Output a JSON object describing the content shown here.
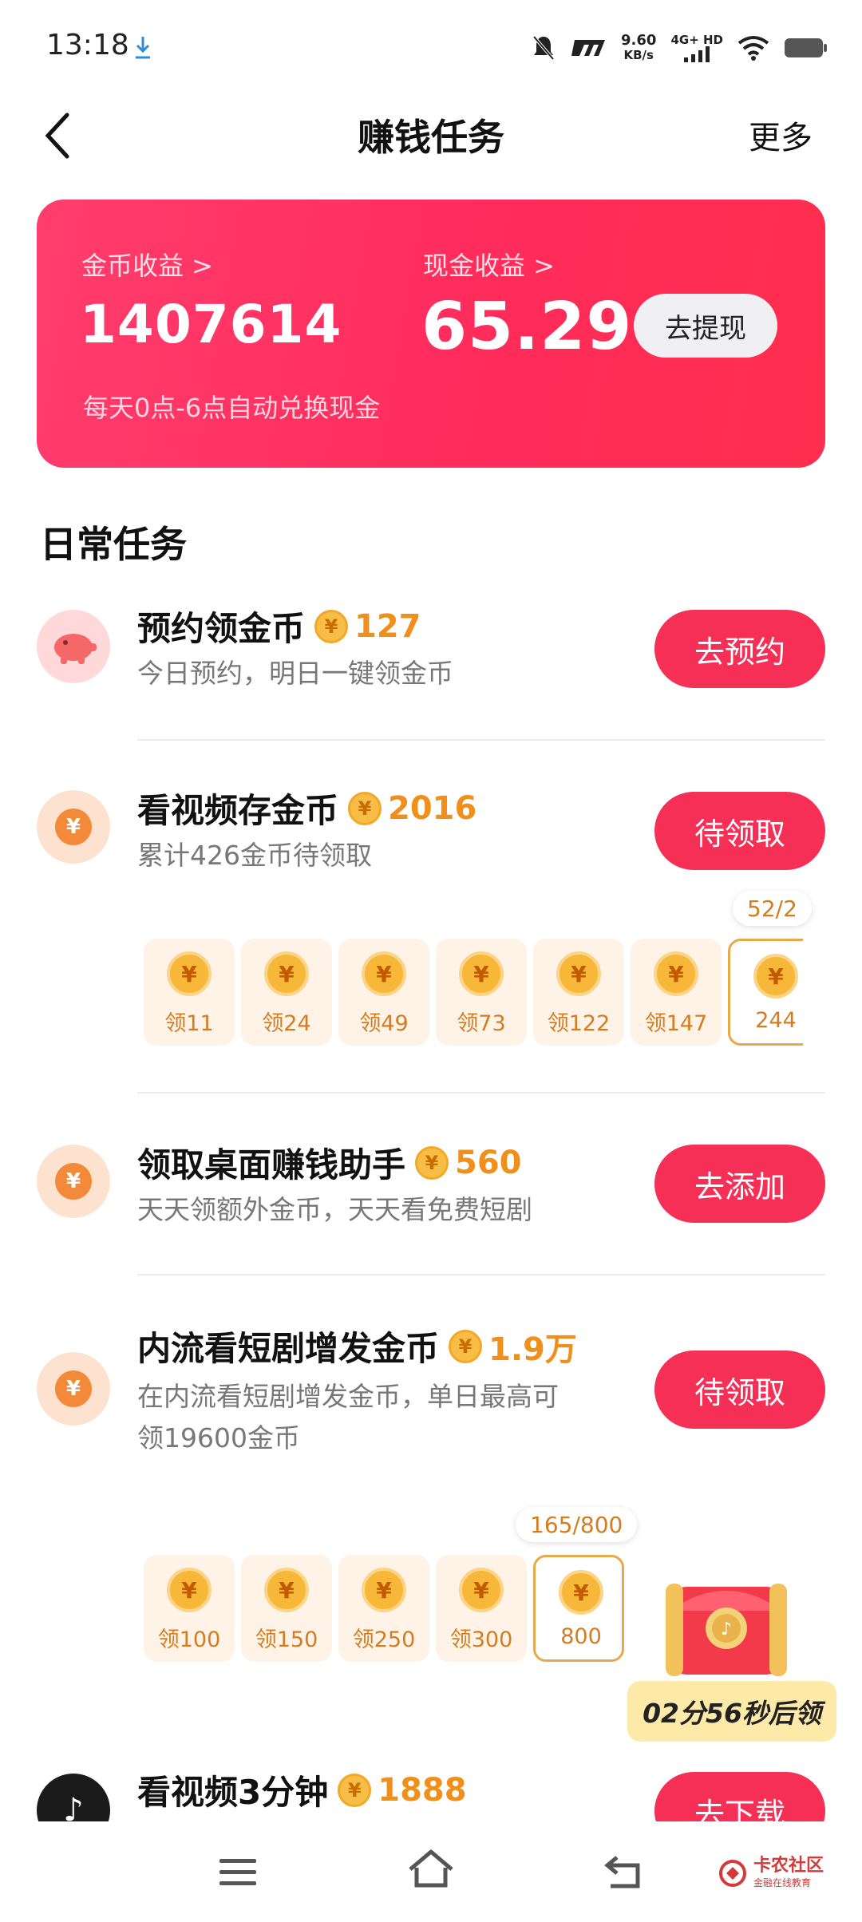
{
  "status_bar": {
    "time": "13:18",
    "net_speed": "9.60",
    "net_unit": "KB/s",
    "signal_label": "4G+ HD"
  },
  "header": {
    "title": "赚钱任务",
    "more": "更多"
  },
  "earnings": {
    "coin_label": "金币收益 >",
    "coin_value": "1407614",
    "cash_label": "现金收益 >",
    "cash_value": "65.29",
    "withdraw": "去提现",
    "note": "每天0点-6点自动兑换现金"
  },
  "section_title": "日常任务",
  "tasks": [
    {
      "title": "预约领金币",
      "reward": "127",
      "subtitle": "今日预约，明日一键领金币",
      "button": "去预约"
    },
    {
      "title": "看视频存金币",
      "reward": "2016",
      "subtitle": "累计426金币待领取",
      "button": "待领取",
      "progress": "52/2",
      "chips": [
        "领11",
        "领24",
        "领49",
        "领73",
        "领122",
        "领147",
        "244"
      ]
    },
    {
      "title": "领取桌面赚钱助手",
      "reward": "560",
      "subtitle": "天天领额外金币，天天看免费短剧",
      "button": "去添加"
    },
    {
      "title": "内流看短剧增发金币",
      "reward": "1.9万",
      "subtitle_line1": "在内流看短剧增发金币，单日最高可",
      "subtitle_line2": "领19600金币",
      "button": "待领取",
      "progress": "165/800",
      "chips": [
        "领100",
        "领150",
        "领250",
        "领300",
        "800"
      ],
      "countdown": "02分56秒后领"
    },
    {
      "title": "看视频3分钟",
      "reward": "1888",
      "button": "去下载"
    }
  ],
  "coin_symbol": "¥",
  "watermark": {
    "name": "卡农社区",
    "tagline": "金融在线教育"
  },
  "colors": {
    "accent": "#f62f57",
    "card": "#ff3566",
    "reward": "#f0901a"
  }
}
